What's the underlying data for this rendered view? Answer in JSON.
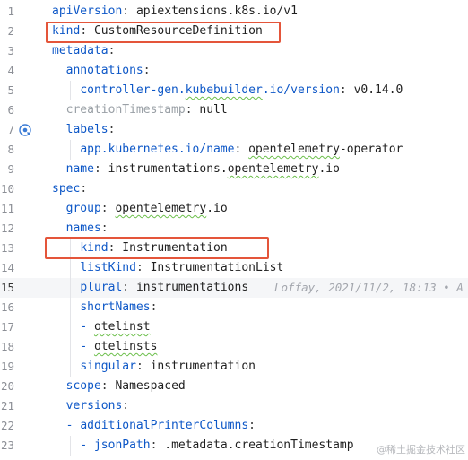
{
  "editor": {
    "lines": [
      {
        "num": "1",
        "tokens": [
          {
            "t": "apiVersion",
            "c": "k"
          },
          {
            "t": ": ",
            "c": "p"
          },
          {
            "t": "apiextensions.k8s.io/v1",
            "c": "v"
          }
        ]
      },
      {
        "num": "2",
        "tokens": [
          {
            "t": "kind",
            "c": "k"
          },
          {
            "t": ": ",
            "c": "p"
          },
          {
            "t": "CustomResourceDefinition",
            "c": "v"
          }
        ]
      },
      {
        "num": "3",
        "tokens": [
          {
            "t": "metadata",
            "c": "k"
          },
          {
            "t": ":",
            "c": "p"
          }
        ]
      },
      {
        "num": "4",
        "tokens": [
          {
            "t": "  "
          },
          {
            "t": "annotations",
            "c": "k"
          },
          {
            "t": ":",
            "c": "p"
          }
        ]
      },
      {
        "num": "5",
        "tokens": [
          {
            "t": "    "
          },
          {
            "t": "controller-gen.",
            "c": "k"
          },
          {
            "t": "kubebuilder",
            "c": "k",
            "sq": true
          },
          {
            "t": ".io/version",
            "c": "k"
          },
          {
            "t": ": ",
            "c": "p"
          },
          {
            "t": "v0.14.0",
            "c": "v"
          }
        ]
      },
      {
        "num": "6",
        "tokens": [
          {
            "t": "  "
          },
          {
            "t": "creationTimestamp",
            "c": "g"
          },
          {
            "t": ": ",
            "c": "p"
          },
          {
            "t": "null",
            "c": "v"
          }
        ]
      },
      {
        "num": "7",
        "tokens": [
          {
            "t": "  "
          },
          {
            "t": "labels",
            "c": "k"
          },
          {
            "t": ":",
            "c": "p"
          }
        ]
      },
      {
        "num": "8",
        "tokens": [
          {
            "t": "    "
          },
          {
            "t": "app.kubernetes.io/name",
            "c": "k"
          },
          {
            "t": ": ",
            "c": "p"
          },
          {
            "t": "opentelemetry",
            "c": "v",
            "sq": true
          },
          {
            "t": "-operator",
            "c": "v"
          }
        ]
      },
      {
        "num": "9",
        "tokens": [
          {
            "t": "  "
          },
          {
            "t": "name",
            "c": "k"
          },
          {
            "t": ": ",
            "c": "p"
          },
          {
            "t": "instrumentations.",
            "c": "v"
          },
          {
            "t": "opentelemetry",
            "c": "v",
            "sq": true
          },
          {
            "t": ".io",
            "c": "v"
          }
        ]
      },
      {
        "num": "10",
        "tokens": [
          {
            "t": "spec",
            "c": "k"
          },
          {
            "t": ":",
            "c": "p"
          }
        ]
      },
      {
        "num": "11",
        "tokens": [
          {
            "t": "  "
          },
          {
            "t": "group",
            "c": "k"
          },
          {
            "t": ": ",
            "c": "p"
          },
          {
            "t": "opentelemetry",
            "c": "v",
            "sq": true
          },
          {
            "t": ".io",
            "c": "v"
          }
        ]
      },
      {
        "num": "12",
        "tokens": [
          {
            "t": "  "
          },
          {
            "t": "names",
            "c": "k"
          },
          {
            "t": ":",
            "c": "p"
          }
        ]
      },
      {
        "num": "13",
        "tokens": [
          {
            "t": "    "
          },
          {
            "t": "kind",
            "c": "k"
          },
          {
            "t": ": ",
            "c": "p"
          },
          {
            "t": "Instrumentation",
            "c": "v"
          }
        ]
      },
      {
        "num": "14",
        "tokens": [
          {
            "t": "    "
          },
          {
            "t": "listKind",
            "c": "k"
          },
          {
            "t": ": ",
            "c": "p"
          },
          {
            "t": "InstrumentationList",
            "c": "v"
          }
        ]
      },
      {
        "num": "15",
        "tokens": [
          {
            "t": "    "
          },
          {
            "t": "plural",
            "c": "k"
          },
          {
            "t": ": ",
            "c": "p"
          },
          {
            "t": "instrumentations",
            "c": "v"
          }
        ],
        "blame": "Loffay, 2021/11/2, 18:13 • A",
        "current": true
      },
      {
        "num": "16",
        "tokens": [
          {
            "t": "    "
          },
          {
            "t": "shortNames",
            "c": "k"
          },
          {
            "t": ":",
            "c": "p"
          }
        ]
      },
      {
        "num": "17",
        "tokens": [
          {
            "t": "    "
          },
          {
            "t": "- ",
            "c": "k"
          },
          {
            "t": "otelinst",
            "c": "v",
            "sq": true
          }
        ]
      },
      {
        "num": "18",
        "tokens": [
          {
            "t": "    "
          },
          {
            "t": "- ",
            "c": "k"
          },
          {
            "t": "otelinsts",
            "c": "v",
            "sq": true
          }
        ]
      },
      {
        "num": "19",
        "tokens": [
          {
            "t": "    "
          },
          {
            "t": "singular",
            "c": "k"
          },
          {
            "t": ": ",
            "c": "p"
          },
          {
            "t": "instrumentation",
            "c": "v"
          }
        ]
      },
      {
        "num": "20",
        "tokens": [
          {
            "t": "  "
          },
          {
            "t": "scope",
            "c": "k"
          },
          {
            "t": ": ",
            "c": "p"
          },
          {
            "t": "Namespaced",
            "c": "v"
          }
        ]
      },
      {
        "num": "21",
        "tokens": [
          {
            "t": "  "
          },
          {
            "t": "versions",
            "c": "k"
          },
          {
            "t": ":",
            "c": "p"
          }
        ]
      },
      {
        "num": "22",
        "tokens": [
          {
            "t": "  "
          },
          {
            "t": "- ",
            "c": "k"
          },
          {
            "t": "additionalPrinterColumns",
            "c": "k"
          },
          {
            "t": ":",
            "c": "p"
          }
        ]
      },
      {
        "num": "23",
        "tokens": [
          {
            "t": "    "
          },
          {
            "t": "- ",
            "c": "k"
          },
          {
            "t": "jsonPath",
            "c": "k"
          },
          {
            "t": ": ",
            "c": "p"
          },
          {
            "t": ".metadata.creationTimestamp",
            "c": "v"
          }
        ]
      },
      {
        "num": "",
        "tokens": []
      }
    ]
  },
  "gutter_icon": "implemented-marker-icon",
  "watermark": "@稀土掘金技术社区",
  "colors": {
    "key": "#0d57c7",
    "text": "#1f1f1f",
    "highlight": "#e4553a"
  }
}
